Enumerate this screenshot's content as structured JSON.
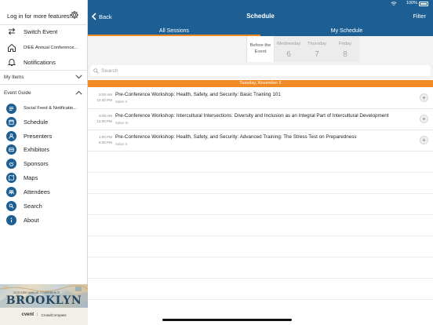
{
  "sidebar": {
    "login_text": "Log in for more features!",
    "items_top": [
      {
        "label": "Switch Event",
        "icon": "switch-arrows-icon"
      },
      {
        "label": "DIEE Annual Conference...",
        "icon": "home-icon"
      },
      {
        "label": "Notifications",
        "icon": "bell-icon"
      }
    ],
    "my_items_label": "My Items",
    "event_guide_label": "Event Guide",
    "guide_items": [
      {
        "label": "Social Feed & Notificatio...",
        "icon": "social-feed-icon"
      },
      {
        "label": "Schedule",
        "icon": "calendar-icon"
      },
      {
        "label": "Presenters",
        "icon": "presenters-icon"
      },
      {
        "label": "Exhibitors",
        "icon": "exhibitors-icon"
      },
      {
        "label": "Sponsors",
        "icon": "sponsors-icon"
      },
      {
        "label": "Maps",
        "icon": "map-icon"
      },
      {
        "label": "Attendees",
        "icon": "attendees-icon"
      },
      {
        "label": "Search",
        "icon": "search-icon"
      },
      {
        "label": "About",
        "icon": "info-icon"
      }
    ],
    "banner": {
      "small_text": "2019 DIEE ANNUAL CONFERENCE",
      "city": "BROOKLYN",
      "logo_1": "cvent",
      "logo_2": "CrowdCompass"
    }
  },
  "status": {
    "battery": "100%"
  },
  "nav": {
    "back_label": "Back",
    "title": "Schedule",
    "filter_label": "Filter"
  },
  "tabs": [
    {
      "label": "All Sessions",
      "active": true
    },
    {
      "label": "My Schedule",
      "active": false
    }
  ],
  "days": [
    {
      "name": "Before the Event",
      "num": "",
      "selected": true
    },
    {
      "name": "Wednesday",
      "num": "6",
      "selected": false
    },
    {
      "name": "Thursday",
      "num": "7",
      "selected": false
    },
    {
      "name": "Friday",
      "num": "8",
      "selected": false
    }
  ],
  "search": {
    "placeholder": "Search"
  },
  "date_header": "Tuesday, November 5",
  "sessions": [
    {
      "start": "9:00 AM",
      "end": "12:00 PM",
      "title": "Pre-Conference Workshop: Health, Safety, and Security: Basic Training 101",
      "room": "Salon II"
    },
    {
      "start": "9:00 AM",
      "end": "12:00 PM",
      "title": "Pre-Conference Workshop: Intercultural Intersections: Diversity and Inclusion as an Integral Part of Intercultural Development",
      "room": "Salon III"
    },
    {
      "start": "1:00 PM",
      "end": "5:00 PM",
      "title": "Pre-Conference Workshop: Health, Safety, and Security: Advanced Training: The Stress Test on Preparedness",
      "room": "Salon II"
    }
  ],
  "colors": {
    "brand_blue": "#1d5f93",
    "accent_orange": "#f08a24"
  }
}
